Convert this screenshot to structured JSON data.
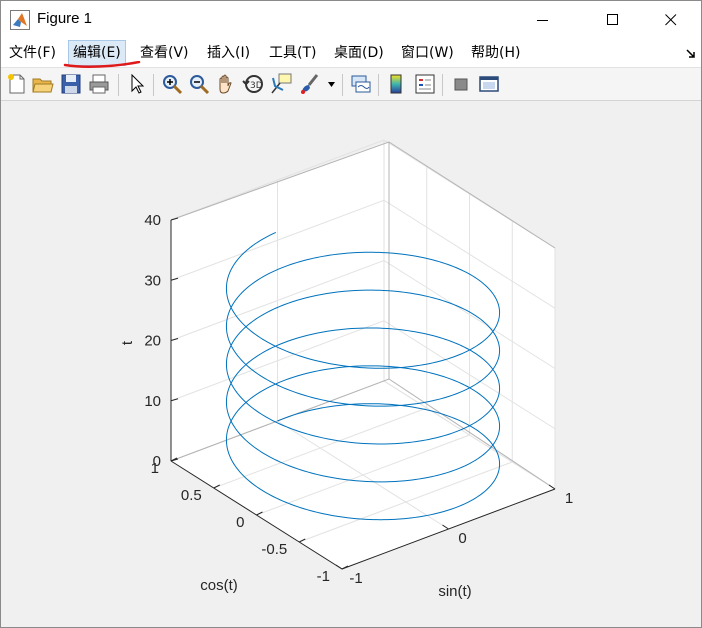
{
  "window": {
    "title": "Figure 1",
    "controls": [
      "minimize",
      "maximize",
      "close"
    ]
  },
  "menu": [
    {
      "label": "文件(F)"
    },
    {
      "label": "编辑(E)",
      "highlighted": true
    },
    {
      "label": "查看(V)"
    },
    {
      "label": "插入(I)"
    },
    {
      "label": "工具(T)"
    },
    {
      "label": "桌面(D)"
    },
    {
      "label": "窗口(W)"
    },
    {
      "label": "帮助(H)"
    }
  ],
  "toolbar_icons": [
    "new-figure-icon",
    "open-file-icon",
    "save-icon",
    "print-icon",
    "pointer-icon",
    "zoom-in-icon",
    "zoom-out-icon",
    "pan-hand-icon",
    "rotate-3d-icon",
    "data-cursor-icon",
    "brush-icon",
    "brush-dropdown-icon",
    "link-plot-icon",
    "colorbar-icon",
    "legend-icon",
    "hide-plot-tools-icon",
    "show-plot-tools-icon"
  ],
  "chart_data": {
    "type": "line",
    "projection": "3d",
    "series": [
      {
        "x_expr": "sin(t)",
        "y_expr": "cos(t)",
        "z_expr": "t",
        "t_range": [
          0,
          31.4
        ],
        "color": "#0072bd"
      }
    ],
    "xlabel": "sin(t)",
    "ylabel": "cos(t)",
    "zlabel": "t",
    "xlim": [
      -1,
      1
    ],
    "ylim": [
      -1,
      1
    ],
    "zlim": [
      0,
      40
    ],
    "xticks": [
      "-1",
      "0",
      "1"
    ],
    "yticks": [
      "-1",
      "-0.5",
      "0",
      "0.5",
      "1"
    ],
    "zticks": [
      "0",
      "10",
      "20",
      "30",
      "40"
    ],
    "grid": true,
    "view": {
      "azimuth": -37.5,
      "elevation": 30
    }
  }
}
